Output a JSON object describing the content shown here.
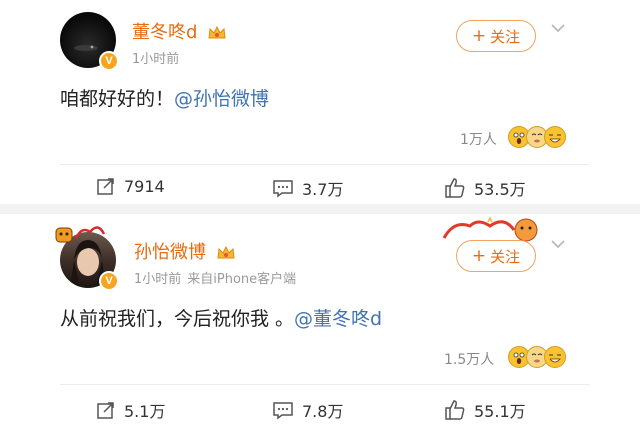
{
  "posts": [
    {
      "author": "董冬咚d",
      "time": "1小时前",
      "source": "",
      "text_before": "咱都好好的！",
      "mention": "@孙怡微博",
      "text_after": "",
      "reaction_count": "1万人",
      "reposts": "7914",
      "comments": "3.7万",
      "likes": "53.5万",
      "follow_label": "关注",
      "verified_mark": "V"
    },
    {
      "author": "孙怡微博",
      "time": "1小时前",
      "source": "来自iPhone客户端",
      "text_before": "从前祝我们，今后祝你我 。",
      "mention": "@董冬咚d",
      "text_after": "",
      "reaction_count": "1.5万人",
      "reposts": "5.1万",
      "comments": "7.8万",
      "likes": "55.1万",
      "follow_label": "关注",
      "verified_mark": "V"
    }
  ],
  "colors": {
    "name": "#e86b0f",
    "mention": "#3f74b3",
    "follow_border": "#f3a35e",
    "verified": "#f7a520",
    "muted": "#9a9a9a"
  },
  "icons": {
    "repost": "repost-icon",
    "comment": "comment-icon",
    "like": "thumbs-up-icon",
    "more": "chevron-down-icon",
    "crown": "crown-badge-icon",
    "reactions": "reaction-emoji-icons"
  }
}
